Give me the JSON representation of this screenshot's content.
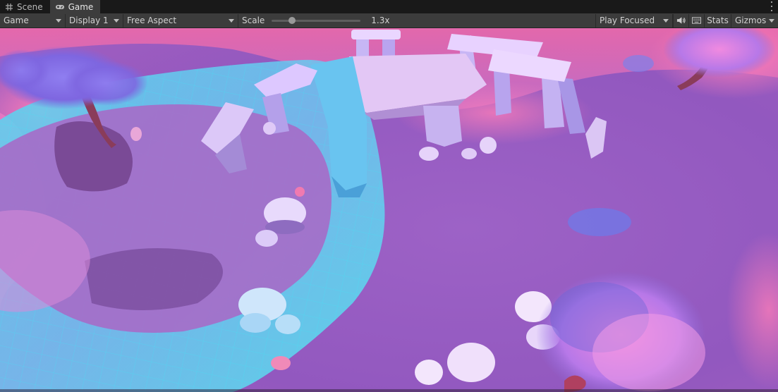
{
  "tabs": [
    {
      "label": "Scene",
      "icon": "grid-icon",
      "active": false
    },
    {
      "label": "Game",
      "icon": "gamepad-icon",
      "active": true
    }
  ],
  "toolbar": {
    "view_mode": "Game",
    "display": "Display 1",
    "aspect": "Free Aspect",
    "scale_label": "Scale",
    "scale_value": "1.3x",
    "play_mode": "Play Focused",
    "stats_label": "Stats",
    "gizmos_label": "Gizmos"
  },
  "colors": {
    "panel": "#3c3c3c",
    "tabbar": "#191919",
    "highlight_water": "#4ff0f5",
    "ground": "#9a5cc2"
  }
}
